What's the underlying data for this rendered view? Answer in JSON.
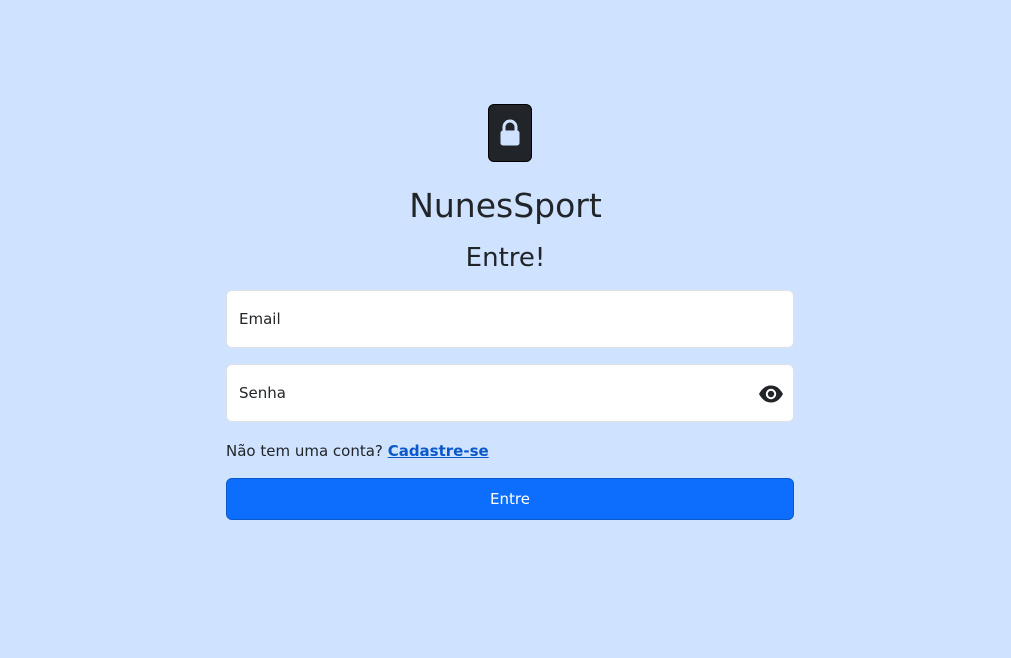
{
  "brand": {
    "name": "NunesSport"
  },
  "form": {
    "heading": "Entre!",
    "email_placeholder": "Email",
    "password_placeholder": "Senha",
    "signup_prompt": "Não tem uma conta?",
    "signup_link": "Cadastre-se",
    "submit_label": "Entre"
  },
  "icons": {
    "logo": "lock-icon",
    "password_toggle": "eye-icon"
  },
  "colors": {
    "background": "#cfe2ff",
    "primary": "#0d6efd",
    "link": "#0a58ca",
    "dark": "#212529"
  }
}
